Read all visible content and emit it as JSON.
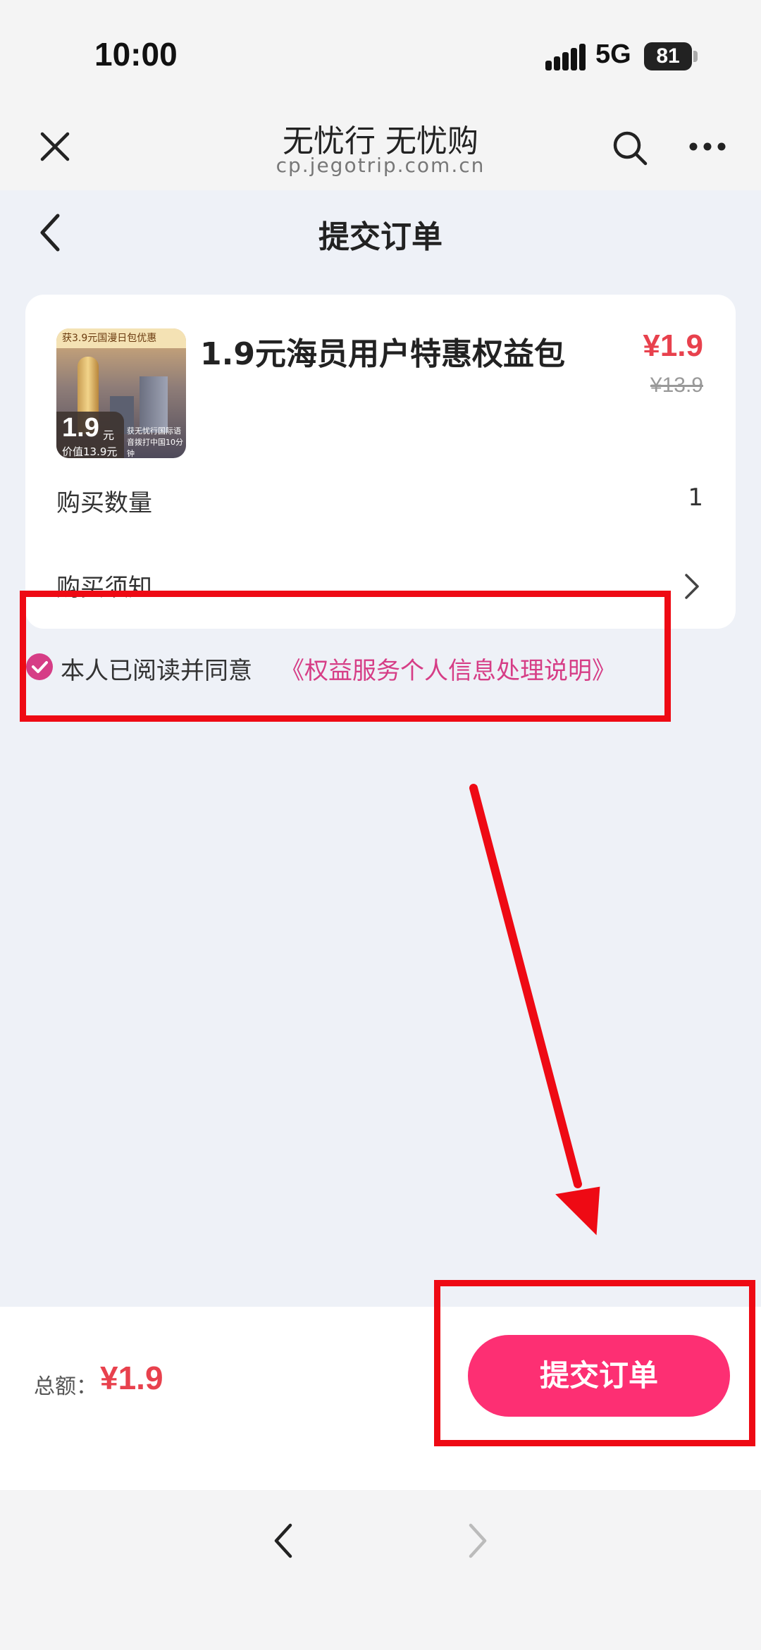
{
  "status_bar": {
    "time": "10:00",
    "network": "5G",
    "battery": "81"
  },
  "browser": {
    "title": "无忧行 无忧购",
    "url": "cp.jegotrip.com.cn"
  },
  "page": {
    "title": "提交订单"
  },
  "product": {
    "name": "1.9元海员用户特惠权益包",
    "price": "¥1.9",
    "original_price": "¥13.9",
    "thumbnail": {
      "banner": "获3.9元国漫日包优惠",
      "price": "1.9",
      "unit": "元",
      "worth": "价值13.9元",
      "note": "获无忧行国际语音拨打中国10分钟"
    }
  },
  "rows": {
    "quantity_label": "购买数量",
    "quantity_value": "1",
    "notice_label": "购买须知"
  },
  "agreement": {
    "text": "本人已阅读并同意",
    "link": "《权益服务个人信息处理说明》",
    "checked": true
  },
  "footer": {
    "total_label": "总额：",
    "total_value": "¥1.9",
    "submit_label": "提交订单"
  },
  "colors": {
    "accent": "#fd2f73",
    "price": "#e8414d",
    "link": "#d63d86",
    "annotation": "#ee0a14",
    "background": "#eef1f7"
  }
}
